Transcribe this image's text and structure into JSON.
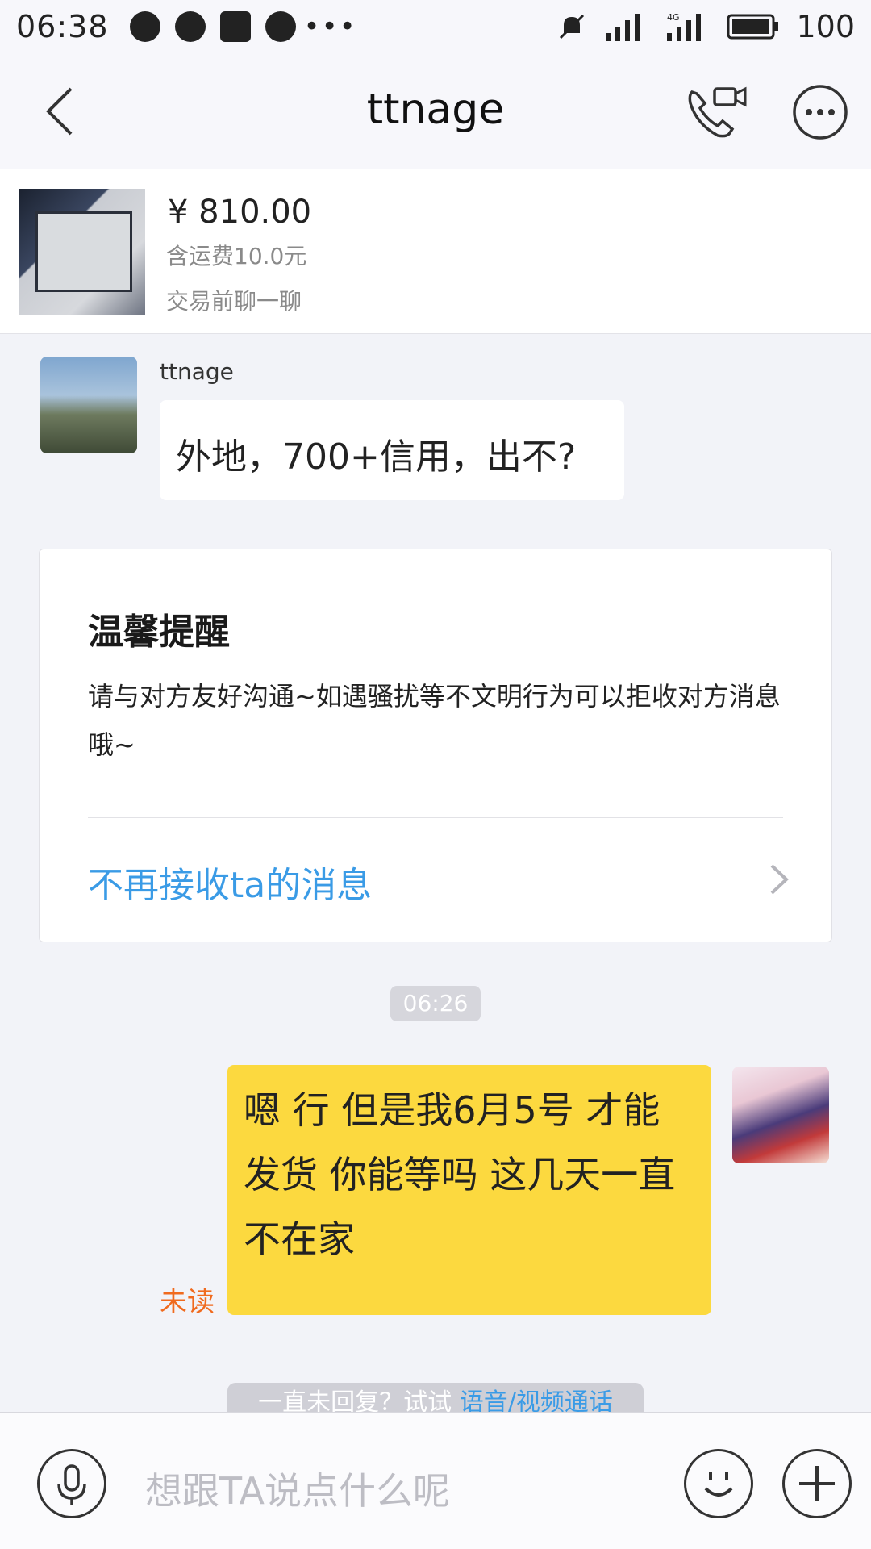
{
  "status_bar": {
    "time": "06:38",
    "battery": "100"
  },
  "header": {
    "title": "ttnage"
  },
  "product": {
    "price": "¥ 810.00",
    "shipping": "含运费10.0元",
    "chat_prompt": "交易前聊一聊"
  },
  "messages": {
    "received": {
      "sender": "ttnage",
      "text": "外地，700+信用，出不?"
    },
    "sent": {
      "text": "嗯 行 但是我6月5号 才能发货 你能等吗 这几天一直不在家",
      "status": "未读"
    },
    "timestamp": "06:26"
  },
  "reminder": {
    "title": "温馨提醒",
    "body": "请与对方友好沟通~如遇骚扰等不文明行为可以拒收对方消息哦~",
    "action": "不再接收ta的消息"
  },
  "hint": {
    "prefix": "一直未回复？试试 ",
    "link": "语音/视频通话"
  },
  "input": {
    "placeholder": "想跟TA说点什么呢"
  },
  "colors": {
    "accent_blue": "#3a9be6",
    "sent_bubble": "#fcd93f",
    "unread_orange": "#f06a1e",
    "background": "#f2f3f8"
  }
}
